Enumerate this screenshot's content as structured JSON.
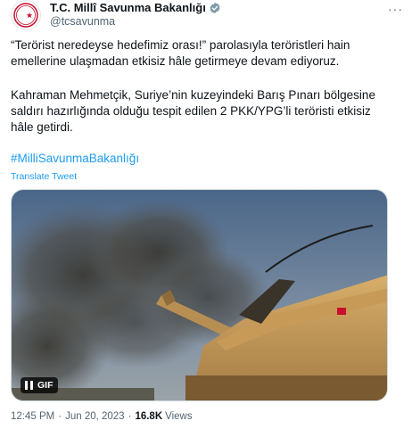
{
  "author": {
    "display_name": "T.C. Millî Savunma Bakanlığı",
    "handle": "@tcsavunma",
    "avatar_icon": "crescent-star-emblem-icon",
    "verified_icon": "verified-badge-icon",
    "verified_color": "#829aab"
  },
  "menu": {
    "more_label": "···"
  },
  "tweet": {
    "paragraph_1": "“Terörist neredeyse hedefimiz orası!” parolasıyla teröristleri hain emellerine ulaşmadan etkisiz hâle getirmeye devam ediyoruz.",
    "paragraph_2": "Kahraman Mehmetçik, Suriye’nin kuzeyindeki Barış Pınarı bölgesine saldırı hazırlığında olduğu tespit edilen 2 PKK/YPG’li teröristi etkisiz hâle getirdi.",
    "hashtag": "#MilliSavunmaBakanlığı",
    "translate_label": "Translate Tweet"
  },
  "media": {
    "gif_label": "GIF",
    "pause_icon": "pause-icon"
  },
  "meta": {
    "time": "12:45 PM",
    "date": "Jun 20, 2023",
    "views_count": "16.8K",
    "views_label": "Views",
    "separator": "·"
  },
  "colors": {
    "link": "#1d9bf0",
    "secondary_text": "#536471",
    "primary_text": "#0f1419"
  }
}
